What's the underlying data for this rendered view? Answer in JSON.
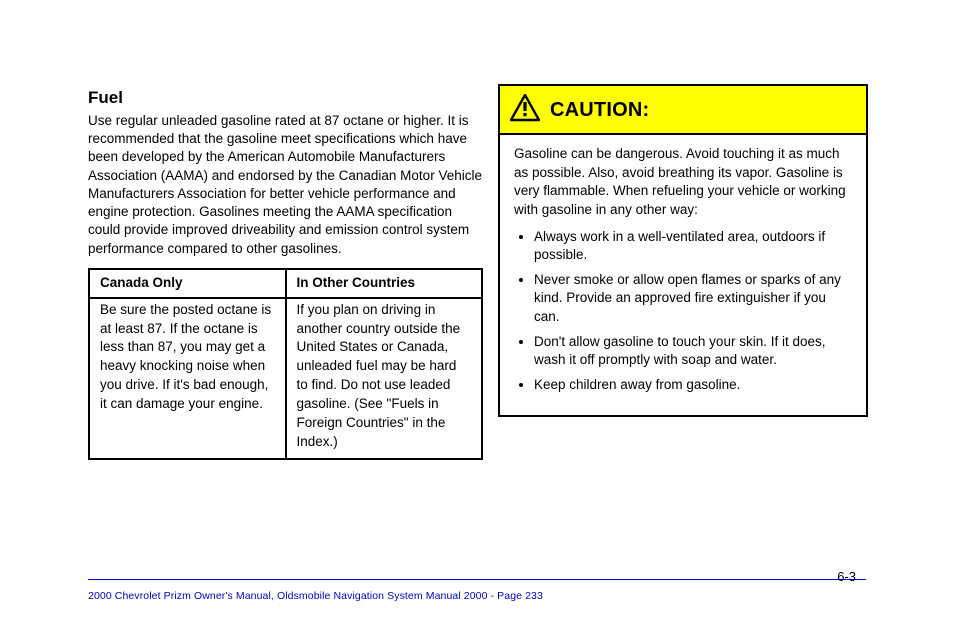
{
  "left": {
    "heading": "Fuel",
    "intro": "Use regular unleaded gasoline rated at 87 octane or higher. It is recommended that the gasoline meet specifications which have been developed by the American Automobile Manufacturers Association (AAMA) and endorsed by the Canadian Motor Vehicle Manufacturers Association for better vehicle performance and engine protection. Gasolines meeting the AAMA specification could provide improved driveability and emission control system performance compared to other gasolines.",
    "table": {
      "header_left": "Canada Only",
      "header_right": "In Other Countries",
      "cell_left": "Be sure the posted octane is at least 87. If the octane is less than 87, you may get a heavy knocking noise when you drive. If it's bad enough, it can damage your engine.",
      "cell_right": "If you plan on driving in another country outside the United States or Canada, unleaded fuel may be hard to find. Do not use leaded gasoline. (See \"Fuels in Foreign Countries\" in the Index.)"
    }
  },
  "caution": {
    "title": "CAUTION:",
    "intro": "Gasoline can be dangerous. Avoid touching it as much as possible. Also, avoid breathing its vapor. Gasoline is very flammable. When refueling your vehicle or working with gasoline in any other way:",
    "bullets": [
      "Always work in a well-ventilated area, outdoors if possible.",
      "Never smoke or allow open flames or sparks of any kind. Provide an approved fire extinguisher if you can.",
      "Don't allow gasoline to touch your skin. If it does, wash it off promptly with soap and water.",
      "Keep children away from gasoline."
    ]
  },
  "page_number": "6-3",
  "footer": "2000 Chevrolet Prizm Owner's Manual, Oldsmobile Navigation System Manual 2000 - Page 233"
}
